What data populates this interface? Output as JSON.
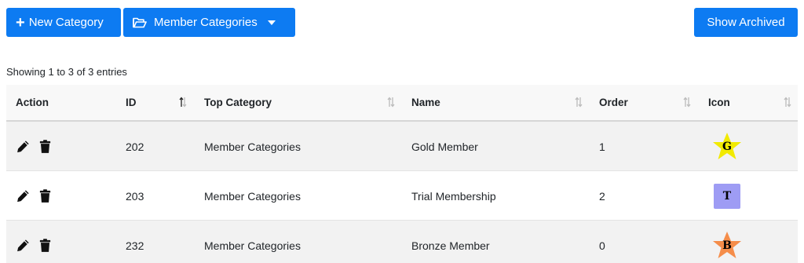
{
  "toolbar": {
    "new_category_label": "New Category",
    "member_categories_label": "Member Categories",
    "show_archived_label": "Show Archived"
  },
  "entries_info": "Showing 1 to 3 of 3 entries",
  "table": {
    "headers": {
      "action": "Action",
      "id": "ID",
      "top_category": "Top Category",
      "name": "Name",
      "order": "Order",
      "icon": "Icon"
    },
    "rows": [
      {
        "id": "202",
        "top_category": "Member Categories",
        "name": "Gold Member",
        "order": "1",
        "icon_letter": "G",
        "icon_shape": "star",
        "icon_color": "#f2ea00"
      },
      {
        "id": "203",
        "top_category": "Member Categories",
        "name": "Trial Membership",
        "order": "2",
        "icon_letter": "T",
        "icon_shape": "square",
        "icon_color": "#9e9cf4"
      },
      {
        "id": "232",
        "top_category": "Member Categories",
        "name": "Bronze Member",
        "order": "0",
        "icon_letter": "B",
        "icon_shape": "star",
        "icon_color": "#f58d4a"
      }
    ]
  },
  "colors": {
    "primary": "#0d7bf2",
    "row_alt": "#f2f2f2",
    "header_bg": "#f8f8f8"
  },
  "icons": {
    "edit": "pencil-icon",
    "delete": "trash-icon",
    "folder": "folder-open-icon",
    "sort": "sort-icon"
  }
}
